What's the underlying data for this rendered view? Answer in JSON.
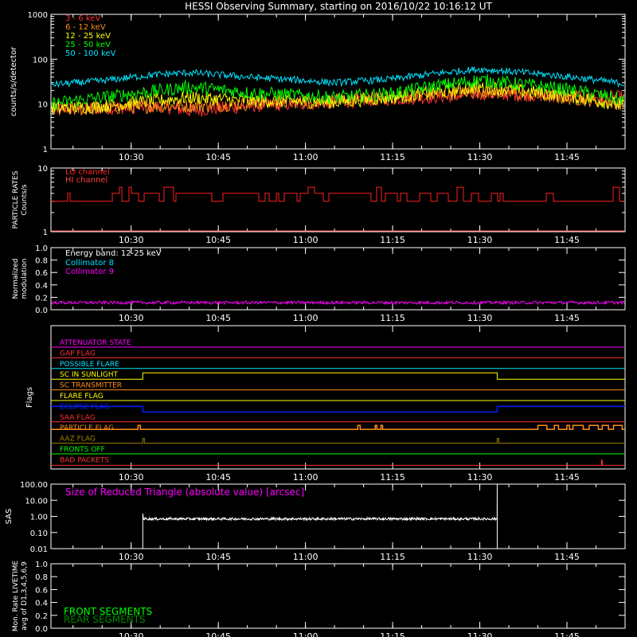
{
  "title": "HESSI Observing Summary, starting on 2016/10/22 10:16:12 UT",
  "time_ticks": [
    "10:30",
    "10:45",
    "11:00",
    "11:15",
    "11:30",
    "11:45"
  ],
  "chart_data": [
    {
      "type": "line",
      "name": "lightcurves",
      "ylabel": "counts/s/detector",
      "yscale": "log",
      "ylim": [
        1,
        1000
      ],
      "yticks": [
        "1000",
        "100",
        "10",
        "1"
      ],
      "series": [
        {
          "name": "3 - 6 keV",
          "color": "#ff3030",
          "level": [
            8,
            8,
            9,
            7,
            9,
            11,
            13,
            15,
            17,
            14
          ]
        },
        {
          "name": "6 - 12 keV",
          "color": "#ff8c1a",
          "level": [
            7,
            8,
            9,
            9,
            10,
            12,
            14,
            17,
            19,
            10
          ]
        },
        {
          "name": "12 - 25 keV",
          "color": "#ffff00",
          "level": [
            8,
            9,
            12,
            14,
            12,
            11,
            14,
            20,
            24,
            9
          ]
        },
        {
          "name": "25 - 50 keV",
          "color": "#00ff00",
          "level": [
            10,
            14,
            20,
            24,
            18,
            14,
            17,
            28,
            34,
            12
          ]
        },
        {
          "name": "50 - 100 keV",
          "color": "#00e5ff",
          "level": [
            27,
            33,
            46,
            50,
            40,
            30,
            36,
            52,
            60,
            28
          ]
        }
      ],
      "series_x": [
        "10:16",
        "10:25",
        "10:35",
        "10:40",
        "10:50",
        "11:05",
        "11:15",
        "11:25",
        "11:30",
        "11:55"
      ]
    },
    {
      "type": "line",
      "name": "particle-rates",
      "ylabel": "PARTICLE RATES Counts/s",
      "yscale": "log",
      "ylim": [
        1,
        10
      ],
      "yticks": [
        "10",
        "1"
      ],
      "series": [
        {
          "name": "LO channel",
          "color": "#ff2020"
        },
        {
          "name": "HI channel",
          "color": "#ff4040"
        }
      ]
    },
    {
      "type": "line",
      "name": "modulation",
      "ylabel": "Normalized modulation",
      "ylim": [
        0,
        1
      ],
      "yticks": [
        "1.0",
        "0.8",
        "0.6",
        "0.4",
        "0.2",
        "0.0"
      ],
      "annotation": "Energy band: 12-25 keV",
      "series": [
        {
          "name": "Collimator 8",
          "color": "#00e5ff"
        },
        {
          "name": "Collimator 9",
          "color": "#ff00ff",
          "level": 0.1
        }
      ]
    },
    {
      "type": "line",
      "name": "flags",
      "ylabel": "Flags",
      "flags": [
        {
          "name": "ATTENUATOR STATE",
          "color": "#ff00ff"
        },
        {
          "name": "GAP FLAG",
          "color": "#ff3030"
        },
        {
          "name": "POSSIBLE FLARE",
          "color": "#00e5ff"
        },
        {
          "name": "SC IN SUNLIGHT",
          "color": "#ffff00"
        },
        {
          "name": "SC TRANSMITTER",
          "color": "#ff8c1a"
        },
        {
          "name": "FLARE FLAG",
          "color": "#ffff00"
        },
        {
          "name": "ECLIPSE FLAG",
          "color": "#0020ff"
        },
        {
          "name": "SAA FLAG",
          "color": "#ff3030"
        },
        {
          "name": "PARTICLE FLAG",
          "color": "#ff8c1a"
        },
        {
          "name": "AAZ FLAG",
          "color": "#a08000"
        },
        {
          "name": "FRONTS OFF",
          "color": "#00ff00"
        },
        {
          "name": "BAD PACKETS",
          "color": "#ff3030"
        }
      ],
      "sunlight_window": [
        "10:32",
        "11:33"
      ]
    },
    {
      "type": "line",
      "name": "sas",
      "ylabel": "SAS",
      "yscale": "log",
      "ylim": [
        0.01,
        100
      ],
      "yticks": [
        "100.00",
        "10.00",
        "1.00",
        "0.10",
        "0.01"
      ],
      "annotation": "Size of Reduced Triangle (absolute value) [arcsec]",
      "series": [
        {
          "name": "",
          "color": "#ffffff",
          "level": 0.7
        }
      ]
    },
    {
      "type": "line",
      "name": "livetime",
      "ylabel": "Mon. Rate LIVETIME avg of D1,3,4,5,6,9",
      "ylim": [
        0,
        1
      ],
      "yticks": [
        "1.0",
        "0.8",
        "0.6",
        "0.4",
        "0.2",
        "0.0"
      ],
      "series": [
        {
          "name": "FRONT SEGMENTS",
          "color": "#00ff00"
        },
        {
          "name": "REAR SEGMENTS",
          "color": "#008800"
        }
      ]
    }
  ]
}
